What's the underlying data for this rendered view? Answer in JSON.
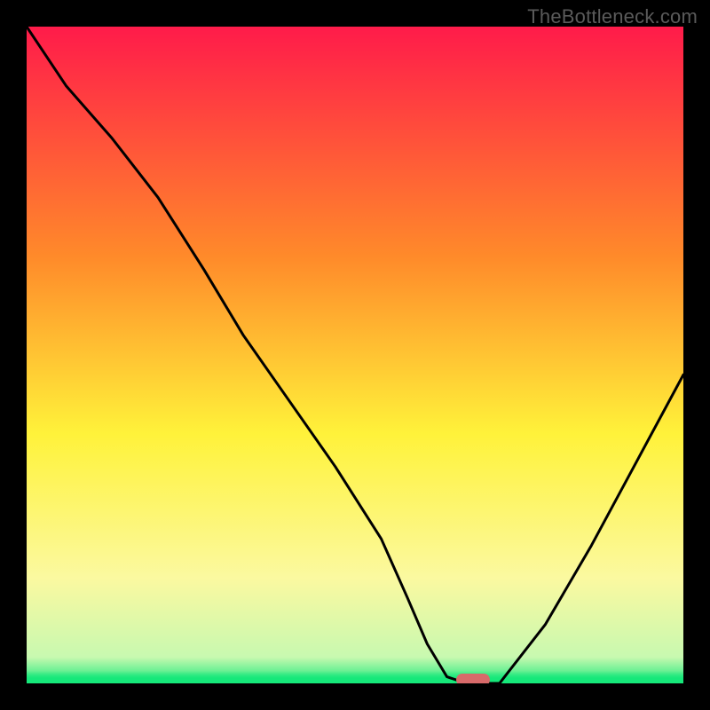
{
  "watermark": "TheBottleneck.com",
  "colors": {
    "marker": "#d86a6a",
    "curve": "#000000",
    "red": "#ff1b4a",
    "orange": "#ff8a2a",
    "yellow": "#fff23a",
    "paleYellow": "#fbf9a0",
    "green": "#16e87a",
    "background": "#000000"
  },
  "chart_data": {
    "type": "line",
    "title": "",
    "xlabel": "",
    "ylabel": "",
    "xlim": [
      0,
      100
    ],
    "ylim": [
      0,
      100
    ],
    "grid": false,
    "legend": false,
    "annotations": [],
    "series": [
      {
        "name": "bottleneck-curve",
        "x": [
          0,
          6,
          13,
          20,
          27,
          33,
          40,
          47,
          54,
          58,
          61,
          64,
          67,
          72,
          79,
          86,
          93,
          100
        ],
        "y": [
          100,
          91,
          83,
          74,
          63,
          53,
          43,
          33,
          22,
          13,
          6,
          1,
          0,
          0,
          9,
          21,
          34,
          47
        ]
      }
    ],
    "optimum_marker": {
      "x": 68,
      "y": 0.5
    },
    "background_gradient_stops": [
      {
        "pct": 0,
        "color": "#ff1b4a"
      },
      {
        "pct": 35,
        "color": "#ff8a2a"
      },
      {
        "pct": 62,
        "color": "#fff23a"
      },
      {
        "pct": 84,
        "color": "#fbf9a0"
      },
      {
        "pct": 96,
        "color": "#c8f9b0"
      },
      {
        "pct": 100,
        "color": "#16e87a"
      }
    ]
  }
}
